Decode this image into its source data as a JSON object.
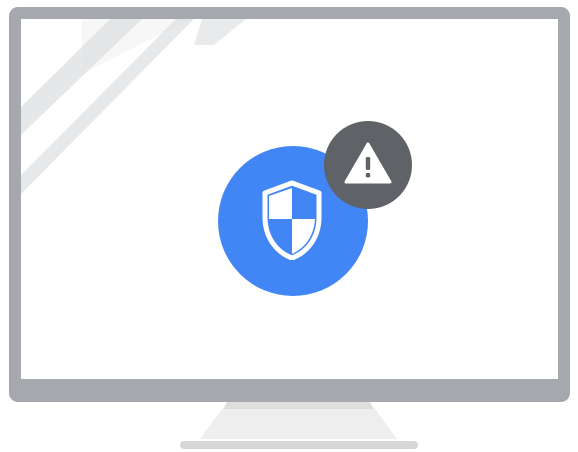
{
  "illustration": {
    "monitor_frame_color": "#a5a8ad",
    "screen_color": "#ffffff",
    "stand_color": "#eeeeee",
    "stand_shadow_color": "#d7d7d7",
    "screen_glare_color": "#d5d8dc"
  },
  "security_badge": {
    "icon": "shield-icon",
    "background_color": "#4285f4",
    "icon_color": "#ffffff"
  },
  "warning_badge": {
    "icon": "warning-icon",
    "background_color": "#5f6368",
    "icon_color": "#ffffff"
  }
}
